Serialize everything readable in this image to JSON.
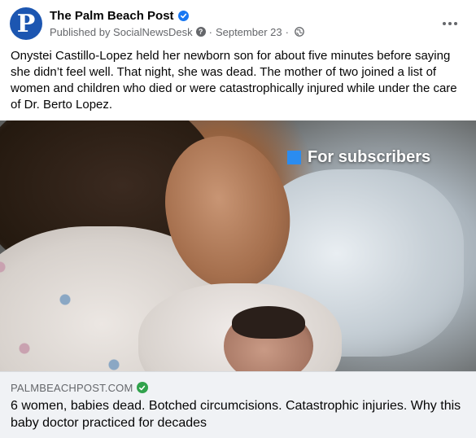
{
  "header": {
    "avatar_letter": "P",
    "page_name": "The Palm Beach Post",
    "published_by": "Published by SocialNewsDesk",
    "date": "September 23",
    "separator": "·",
    "more_icon": "more-horizontal-icon",
    "privacy_icon": "globe-icon",
    "verified_icon": "verified-check-icon"
  },
  "post": {
    "text": "Onystei Castillo-Lopez held her newborn son for about five minutes before saying she didn’t feel well. That night, she was dead. The mother of two joined a list of women and children who died or were catastrophically injured while under the care of Dr. Berto Lopez."
  },
  "media": {
    "badge_text": "For subscribers",
    "badge_color": "#2b8cf0",
    "image_description_icon": "photo-mother-newborn"
  },
  "link_card": {
    "domain": "PALMBEACHPOST.COM",
    "domain_verified_icon": "green-check-icon",
    "headline": "6 women, babies dead. Botched circumcisions. Catastrophic injuries. Why this baby doctor practiced for decades"
  },
  "colors": {
    "brand_blue": "#1877f2",
    "avatar_blue": "#1c56b1",
    "secondary_text": "#65676b",
    "card_background": "#f0f2f5",
    "check_green": "#31a24c"
  }
}
